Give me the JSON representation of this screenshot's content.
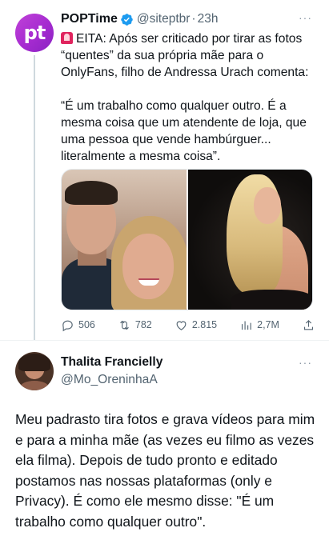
{
  "tweet1": {
    "avatar_text": "pt",
    "display_name": "POPTime",
    "handle": "@siteptbr",
    "separator": "·",
    "time": "23h",
    "more": "···",
    "text": "EITA: Após ser criticado por tirar as fotos “quentes” da sua própria mãe para o OnlyFans, filho de Andressa Urach comenta:",
    "quote": "“É um trabalho como qualquer outro. É a mesma coisa que um atendente de loja, que uma pessoa que vende hambúrguer... literalmente a mesma coisa”.",
    "icon_emoji": "rotating-light-icon",
    "actions": {
      "replies": "506",
      "retweets": "782",
      "likes": "2.815",
      "views": "2,7M"
    }
  },
  "tweet2": {
    "display_name": "Thalita Francielly",
    "handle": "@Mo_OreninhaA",
    "more": "···",
    "text": "Meu padrasto tira fotos e grava vídeos para mim e para a minha mãe (as vezes eu filmo as vezes ela filma). Depois de tudo pronto e editado postamos nas nossas plataformas (only e Privacy). É como ele mesmo disse: \"É um trabalho como qualquer outro\"."
  },
  "colors": {
    "verified_blue": "#1d9bf0",
    "secondary_text": "#536471",
    "brand_purple": "#a52bd0"
  }
}
